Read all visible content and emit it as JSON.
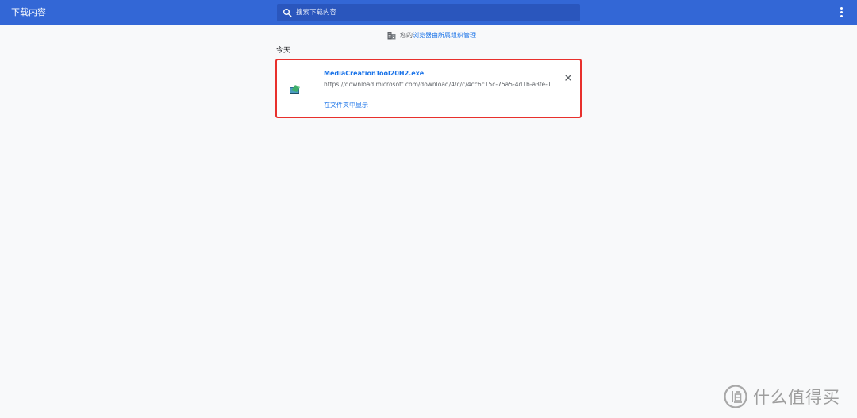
{
  "header": {
    "title": "下载内容",
    "search_placeholder": "搜索下载内容",
    "search_icon": "search-icon",
    "more_icon": "more-vert-icon",
    "colors": {
      "bar": "#3367d6",
      "search": "#2a56bd"
    }
  },
  "managed_notice": {
    "icon": "building-icon",
    "prefix": "您的",
    "link": "浏览器由所属组织管理"
  },
  "sections": [
    {
      "date": "今天",
      "items": [
        {
          "icon": "installer-file-icon",
          "file_name": "MediaCreationTool20H2.exe",
          "url": "https://download.microsoft.com/download/4/c/c/4cc6c15c-75a5-4d1b-a3fe-140a5e...",
          "show_in_folder": "在文件夹中显示",
          "remove_icon": "close-icon",
          "highlight_color": "#e8302c"
        }
      ]
    }
  ],
  "watermark": {
    "logo": "值-logo-icon",
    "text": "什么值得买"
  }
}
